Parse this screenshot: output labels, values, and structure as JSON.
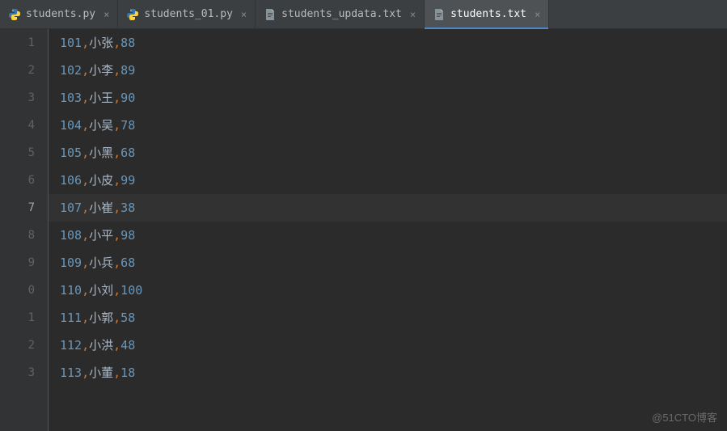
{
  "tabs": [
    {
      "label": "students.py",
      "icon": "py",
      "active": false
    },
    {
      "label": "students_01.py",
      "icon": "py",
      "active": false
    },
    {
      "label": "students_updata.txt",
      "icon": "txt",
      "active": false
    },
    {
      "label": "students.txt",
      "icon": "txt",
      "active": true
    }
  ],
  "gutter_suffixes": [
    "1",
    "2",
    "3",
    "4",
    "5",
    "6",
    "7",
    "8",
    "9",
    "0",
    "1",
    "2",
    "3"
  ],
  "active_line_index": 6,
  "lines": [
    {
      "id": "101",
      "name": "小张",
      "score": "88"
    },
    {
      "id": "102",
      "name": "小李",
      "score": "89"
    },
    {
      "id": "103",
      "name": "小王",
      "score": "90"
    },
    {
      "id": "104",
      "name": "小吴",
      "score": "78"
    },
    {
      "id": "105",
      "name": "小黑",
      "score": "68"
    },
    {
      "id": "106",
      "name": "小皮",
      "score": "99"
    },
    {
      "id": "107",
      "name": "小崔",
      "score": "38"
    },
    {
      "id": "108",
      "name": "小平",
      "score": "98"
    },
    {
      "id": "109",
      "name": "小兵",
      "score": "68"
    },
    {
      "id": "110",
      "name": "小刘",
      "score": "100"
    },
    {
      "id": "111",
      "name": "小郭",
      "score": "58"
    },
    {
      "id": "112",
      "name": "小洪",
      "score": "48"
    },
    {
      "id": "113",
      "name": "小董",
      "score": "18"
    }
  ],
  "watermark": "@51CTO博客"
}
